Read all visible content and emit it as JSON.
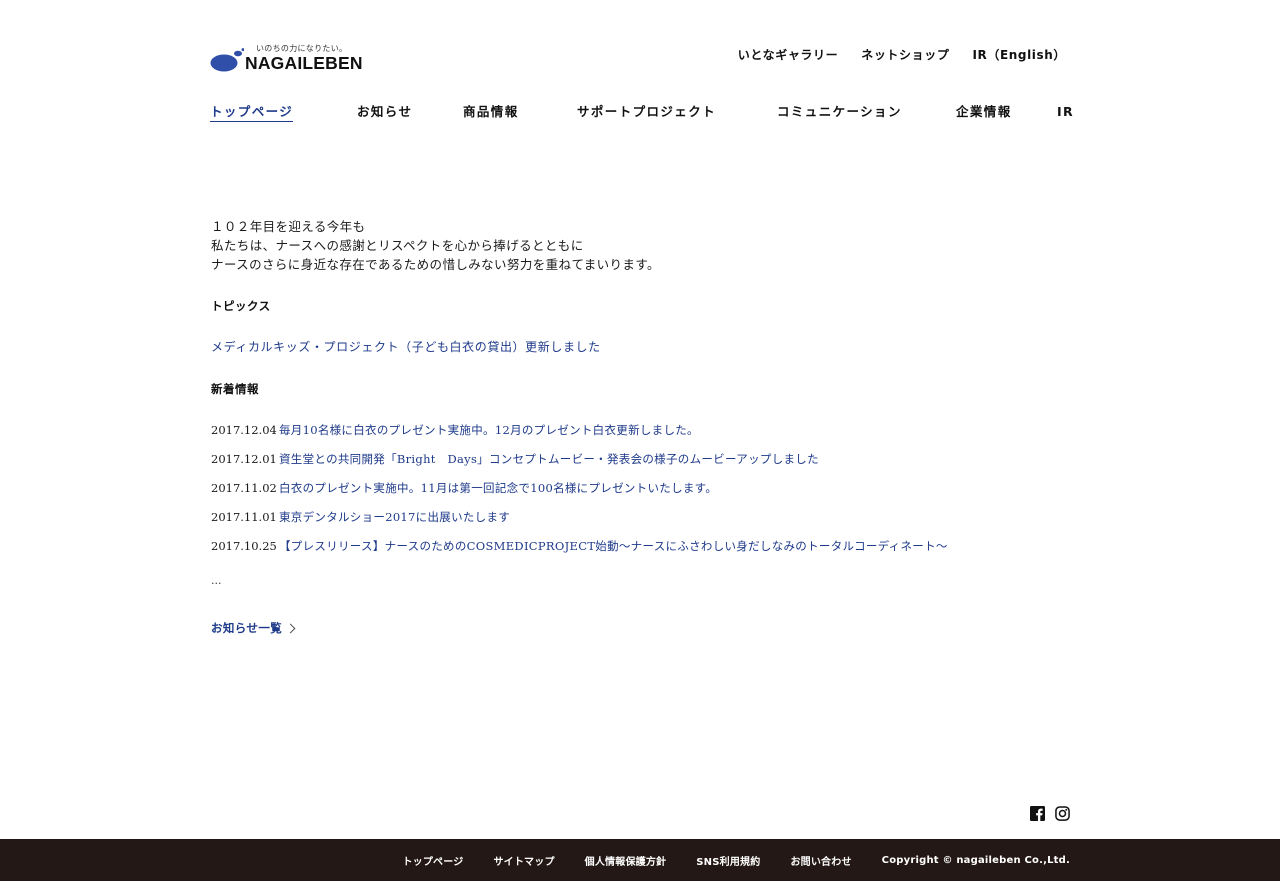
{
  "header": {
    "logo": {
      "tagline": "いのちの力になりたい。",
      "wordmark": "NAGAILEBEN",
      "brand_color": "#2f4fa8"
    },
    "utility_nav": [
      "いとなギャラリー",
      "ネットショップ",
      "IR（English）"
    ],
    "global_nav": [
      {
        "label": "トップページ",
        "current": true
      },
      {
        "label": "お知らせ"
      },
      {
        "label": "商品情報"
      },
      {
        "label": "サポートプロジェクト"
      },
      {
        "label": "コミュニケーション"
      },
      {
        "label": "企業情報"
      },
      {
        "label": "IR"
      }
    ]
  },
  "main": {
    "lead": [
      "１０２年目を迎える今年も",
      "私たちは、ナースへの感謝とリスペクトを心から捧げるとともに",
      "ナースのさらに身近な存在であるための惜しみない努力を重ねてまいります。"
    ],
    "topics_heading": "トピックス",
    "topic_link": "メディカルキッズ・プロジェクト（子ども白衣の貸出）更新しました",
    "news_heading": "新着情報",
    "news": [
      {
        "date": "2017.12.04",
        "title": "毎月10名様に白衣のプレゼント実施中。12月のプレゼント白衣更新しました。"
      },
      {
        "date": "2017.12.01",
        "title": "資生堂との共同開発「Bright　Days」コンセプトムービー・発表会の様子のムービーアップしました"
      },
      {
        "date": "2017.11.02",
        "title": "白衣のプレゼント実施中。11月は第一回記念で100名様にプレゼントいたします。"
      },
      {
        "date": "2017.11.01",
        "title": "東京デンタルショー2017に出展いたします"
      },
      {
        "date": "2017.10.25",
        "title": "【プレスリリース】ナースのためのCOSMEDICPROJECT始動〜ナースにふさわしい身だしなみのトータルコーディネート〜"
      }
    ],
    "ellipsis": "...",
    "more_link": "お知らせ一覧"
  },
  "social": {
    "icons": [
      "facebook-icon",
      "instagram-icon"
    ]
  },
  "footer": {
    "links": [
      "トップページ",
      "サイトマップ",
      "個人情報保護方針",
      "SNS利用規約",
      "お問い合わせ"
    ],
    "copyright": "Copyright © nagaileben Co.,Ltd.",
    "background": "#231815"
  },
  "colors": {
    "link": "#1e3a8a",
    "text": "#1a1a1a"
  }
}
